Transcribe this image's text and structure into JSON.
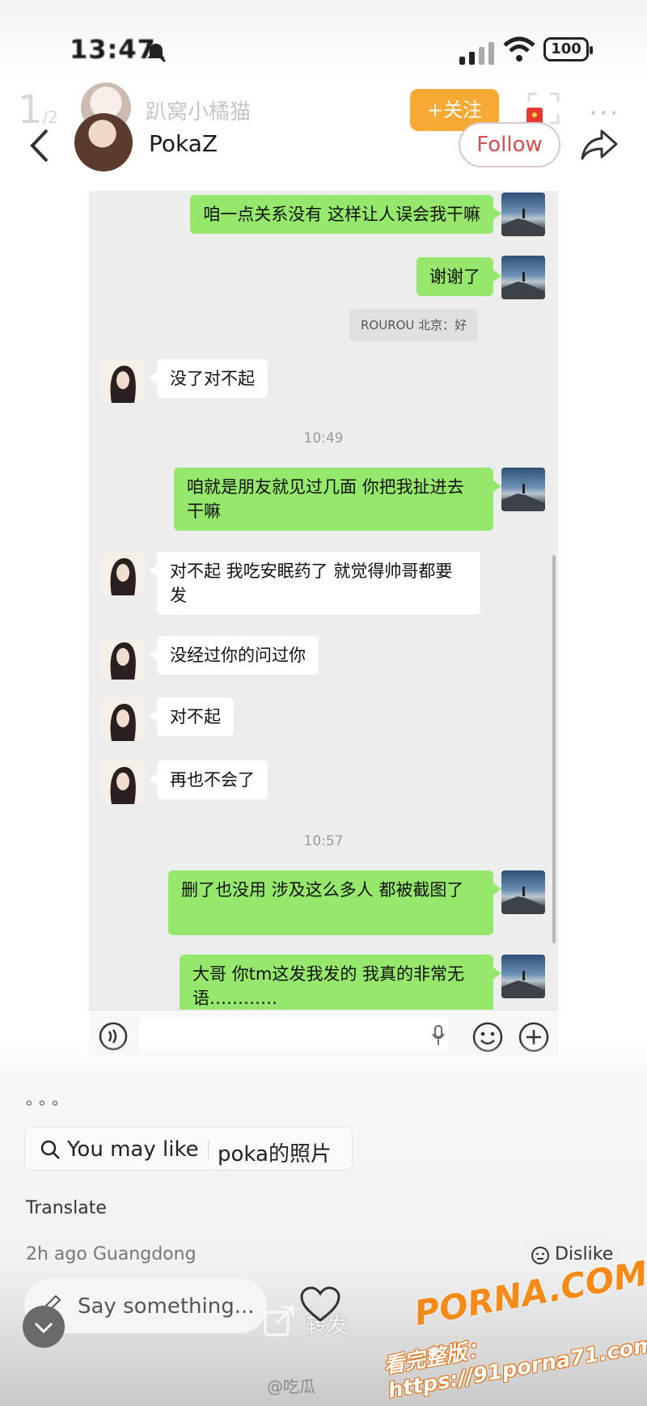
{
  "status_bar": {
    "time": "13:47",
    "battery": "100"
  },
  "header": {
    "page_current": "1",
    "page_total": "/2",
    "ghost_username": "趴窝小橘猫",
    "follow_cn": "+关注",
    "username": "PokaZ",
    "follow_label": "Follow"
  },
  "chat": {
    "messages": [
      {
        "side": "out",
        "text": "咱一点关系没有 这样让人误会我干嘛"
      },
      {
        "side": "out",
        "text": "谢谢了"
      },
      {
        "side": "quote",
        "text": "ROUROU 北京：好"
      },
      {
        "side": "in",
        "text": "没了对不起"
      },
      {
        "side": "time",
        "text": "10:49"
      },
      {
        "side": "out",
        "text": "咱就是朋友就见过几面 你把我扯进去干嘛"
      },
      {
        "side": "in",
        "text": "对不起 我吃安眠药了 就觉得帅哥都要发"
      },
      {
        "side": "in",
        "text": "没经过你的问过你"
      },
      {
        "side": "in",
        "text": "对不起"
      },
      {
        "side": "in",
        "text": "再也不会了"
      },
      {
        "side": "time",
        "text": "10:57"
      },
      {
        "side": "out",
        "text": "删了也没用 涉及这么多人 都被截图了"
      },
      {
        "side": "out",
        "text": "大哥 你tm这发我发的 我真的非常无语…………"
      }
    ]
  },
  "post": {
    "ellipsis": "。。。",
    "you_may_like_label": "You may like",
    "you_may_like_query": "poka的照片",
    "translate": "Translate",
    "meta": "2h ago Guangdong",
    "dislike": "Dislike",
    "comment_placeholder": "Say something...",
    "repost_label": "转发",
    "weibo_watermark": "@吃瓜"
  },
  "watermark": {
    "site": "PORNA.COM",
    "url": "看完整版：https://91porna71.com"
  },
  "icons": {
    "back": "chevron-left-icon",
    "share": "share-arrow-icon",
    "more": "more-dots-icon",
    "search": "search-icon",
    "voice": "voice-icon",
    "emoji": "emoji-icon",
    "plus": "plus-icon",
    "like": "heart-icon"
  },
  "colors": {
    "chat_out_bubble": "#95e86b",
    "chat_in_bubble": "#ffffff",
    "follow_cn": "#f6a11e",
    "follow_text": "#d84e4e"
  }
}
